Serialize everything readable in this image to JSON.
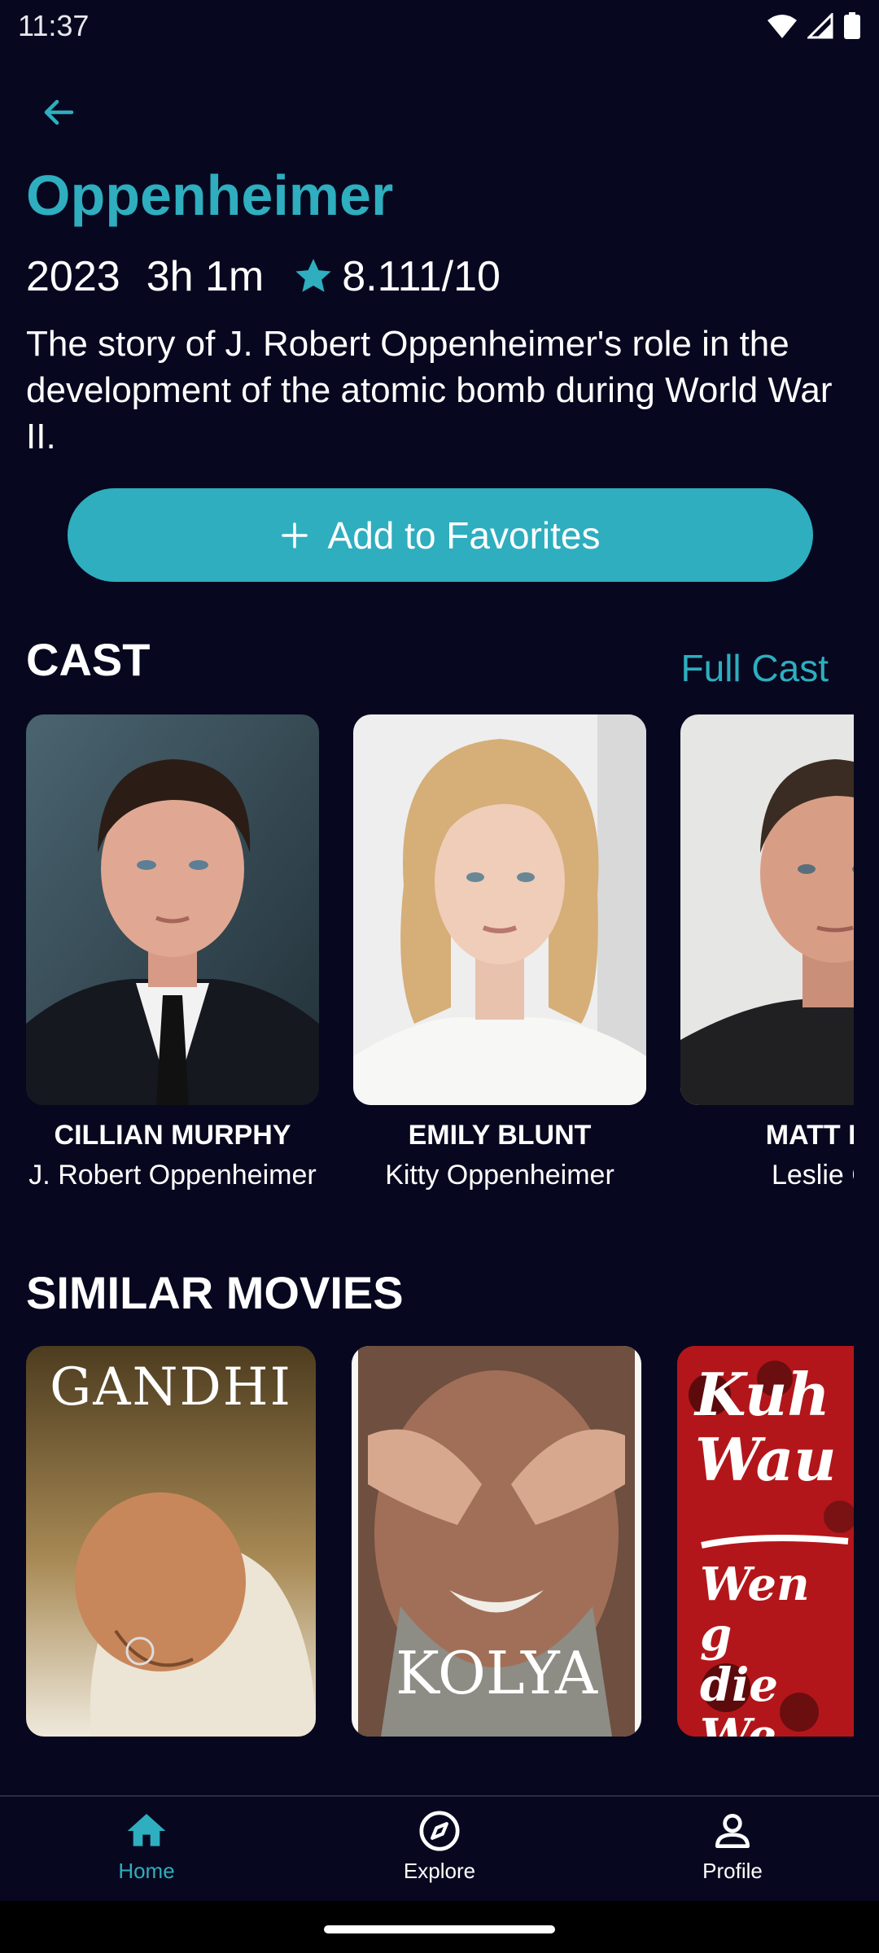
{
  "status_bar": {
    "time": "11:37"
  },
  "movie": {
    "title": "Oppenheimer",
    "year": "2023",
    "runtime": "3h 1m",
    "rating": "8.111/10",
    "overview": "The story of J. Robert Oppenheimer's role in the development of the atomic bomb during World War II."
  },
  "actions": {
    "favorite_label": "Add to Favorites",
    "favorite_icon": "plus-icon"
  },
  "cast": {
    "title": "CAST",
    "full_cast_label": "Full Cast",
    "members": [
      {
        "name": "CILLIAN MURPHY",
        "role": "J. Robert Oppenheimer"
      },
      {
        "name": "EMILY BLUNT",
        "role": "Kitty Oppenheimer"
      },
      {
        "name": "MATT DA",
        "role": "Leslie Gr"
      }
    ]
  },
  "similar": {
    "title": "SIMILAR MOVIES",
    "movies": [
      {
        "poster_text": "GANDHI"
      },
      {
        "poster_text": "KOLYA"
      },
      {
        "poster_text": "Kuh Wau",
        "poster_subtext": "Wen g die We"
      }
    ]
  },
  "nav": {
    "items": [
      {
        "label": "Home",
        "icon": "home-icon",
        "active": true
      },
      {
        "label": "Explore",
        "icon": "compass-icon",
        "active": false
      },
      {
        "label": "Profile",
        "icon": "profile-icon",
        "active": false
      }
    ]
  },
  "colors": {
    "accent": "#2eaebf",
    "background": "#07081f"
  }
}
